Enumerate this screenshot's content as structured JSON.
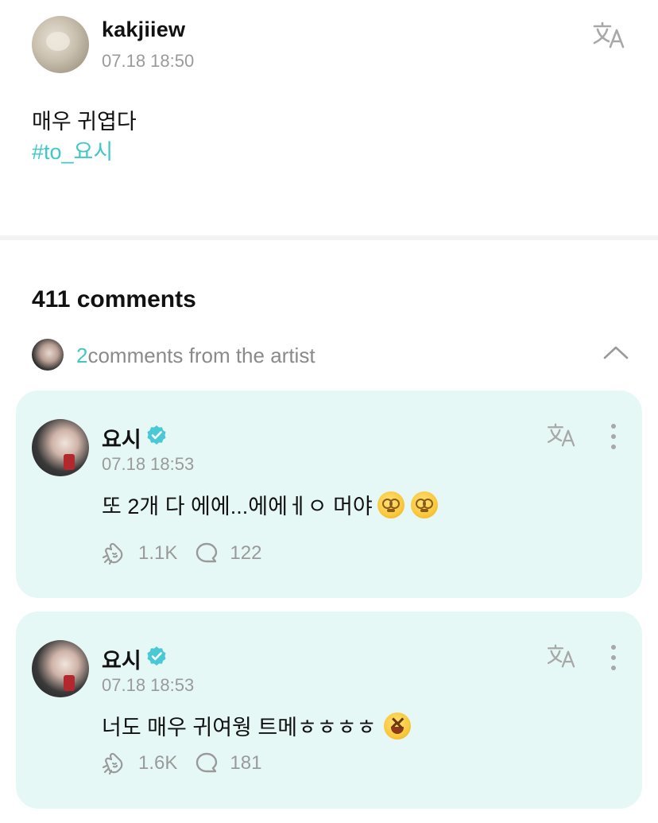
{
  "post": {
    "username": "kakjiiew",
    "time": "07.18 18:50",
    "text": "매우 귀엽다",
    "hashtag": "#to_요시"
  },
  "comments_section": {
    "count_label": "411 comments",
    "artist_count": "2",
    "artist_label": "comments from the artist"
  },
  "comments": [
    {
      "name": "요시",
      "time": "07.18 18:53",
      "text": "또 2개 다 에에...에에ㅔㅇ 머야",
      "emojis": [
        "dizzy-face-emoji",
        "dizzy-face-emoji"
      ],
      "likes": "1.1K",
      "replies": "122"
    },
    {
      "name": "요시",
      "time": "07.18 18:53",
      "text": "너도 매우 귀여웡 트메ㅎㅎㅎㅎ",
      "emojis": [
        "laughing-face-emoji"
      ],
      "likes": "1.6K",
      "replies": "181"
    }
  ],
  "colors": {
    "accent": "#3fc8c8",
    "card_bg": "#e6f8f6",
    "muted": "#9a9a9a"
  }
}
